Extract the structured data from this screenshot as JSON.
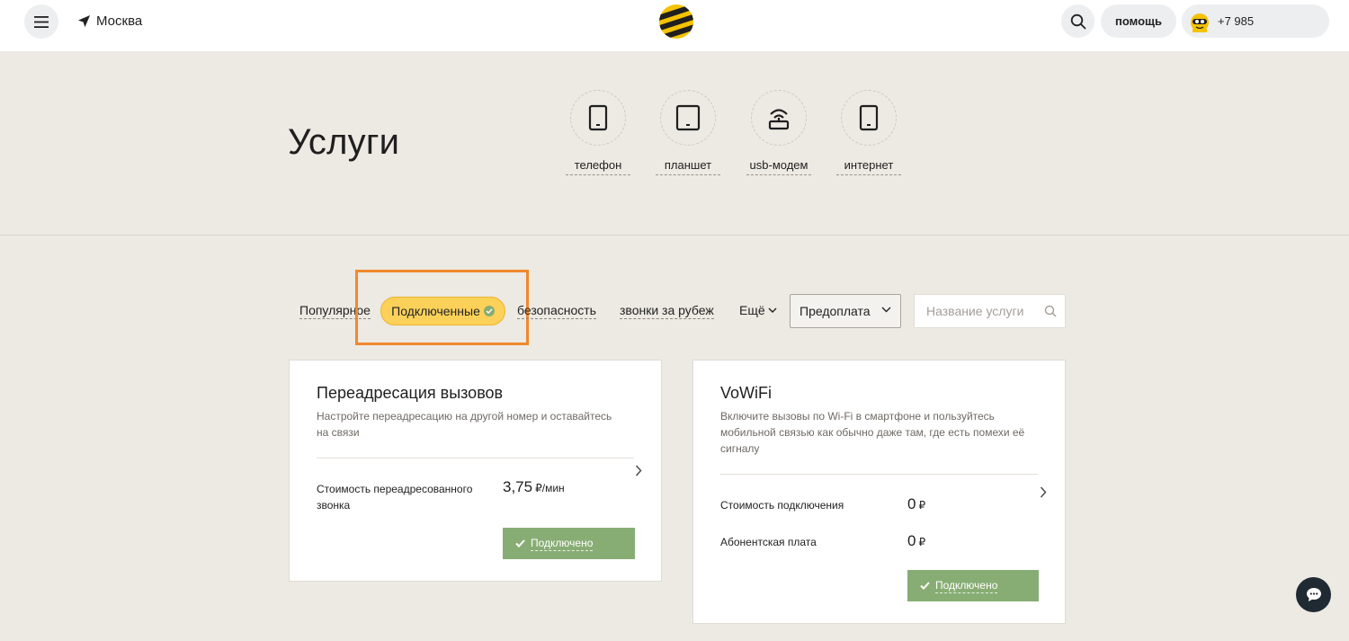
{
  "header": {
    "city": "Москва",
    "help_label": "помощь",
    "phone": "+7 985"
  },
  "hero": {
    "title": "Услуги",
    "devices": [
      {
        "label": "телефон",
        "icon": "phone-icon"
      },
      {
        "label": "планшет",
        "icon": "tablet-icon"
      },
      {
        "label": "usb-модем",
        "icon": "usb-modem-icon"
      },
      {
        "label": "интернет",
        "icon": "sim-device-icon"
      }
    ]
  },
  "tabs": {
    "popular": "Популярное",
    "connected": "Подключенные",
    "security": "безопасность",
    "abroad": "звонки за рубеж",
    "more": "Ещё"
  },
  "filter": {
    "selected": "Предоплата"
  },
  "search": {
    "placeholder": "Название услуги"
  },
  "cards": [
    {
      "title": "Переадресация вызовов",
      "description": "Настройте переадресацию на другой номер и оставайтесь на связи",
      "rows": [
        {
          "label": "Стоимость переадресованного звонка",
          "value": "3,75",
          "unit": "₽/мин"
        }
      ],
      "button": "Подключено"
    },
    {
      "title": "VoWiFi",
      "description": "Включите вызовы по Wi-Fi в смартфоне и пользуйтесь мобильной связью как обычно даже там, где есть помехи её сигналу",
      "rows": [
        {
          "label": "Стоимость подключения",
          "value": "0",
          "unit": "₽"
        },
        {
          "label": "Абонентская плата",
          "value": "0",
          "unit": "₽"
        }
      ],
      "button": "Подключено"
    }
  ],
  "colors": {
    "page_bg": "#ede9e3",
    "active_tab": "#fcd15a",
    "connected_button": "#88ad74",
    "highlight": "#f0892c",
    "brand_yellow": "#f5c200"
  }
}
